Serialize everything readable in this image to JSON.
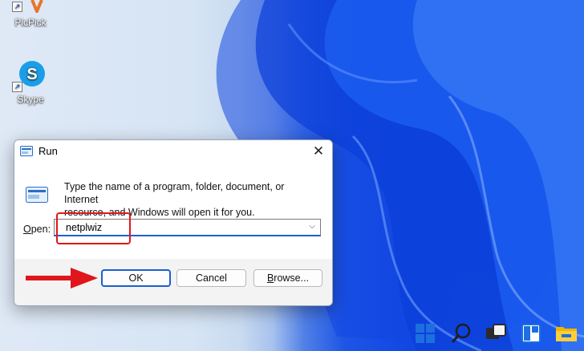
{
  "desktop": {
    "icons": [
      {
        "label": "PicPick",
        "icon": "picpick-icon"
      },
      {
        "label": "Skype",
        "icon": "skype-icon"
      }
    ]
  },
  "run_dialog": {
    "title": "Run",
    "instruction_line1": "Type the name of a program, folder, document, or Internet",
    "instruction_line2": "resource, and Windows will open it for you.",
    "open_label_first": "O",
    "open_label_rest": "pen:",
    "open_value": "netplwiz",
    "ok_label": "OK",
    "cancel_label": "Cancel",
    "browse_label_first": "B",
    "browse_label_rest": "rowse..."
  },
  "annotations": {
    "highlight_color": "#e0161c",
    "arrow_color": "#e0161c"
  },
  "taskbar": {
    "items": [
      "start-icon",
      "search-icon",
      "task-view-icon",
      "widgets-icon",
      "file-explorer-icon"
    ]
  },
  "colors": {
    "accent": "#1a5fd0",
    "dialog_bg": "#f3f3f3"
  }
}
